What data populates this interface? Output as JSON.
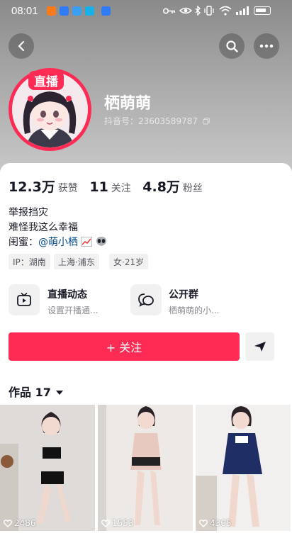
{
  "status_bar": {
    "time": "08:01"
  },
  "profile": {
    "live_badge": "直播",
    "username": "栖萌萌",
    "douyin_id": "抖音号：23603589787"
  },
  "stats": [
    {
      "value": "12.3万",
      "label": "获赞"
    },
    {
      "value": "11",
      "label": "关注"
    },
    {
      "value": "4.8万",
      "label": "粉丝"
    }
  ],
  "bio": {
    "line1": "举报挡灾",
    "line2": "难怪我这么幸福",
    "line3_prefix": "闺蜜：",
    "line3_mention": "@萌小栖"
  },
  "tags": [
    "IP：湖南",
    "上海·浦东",
    "女·21岁"
  ],
  "features": {
    "live": {
      "title": "直播动态",
      "subtitle": "设置开播通..."
    },
    "group": {
      "title": "公开群",
      "subtitle": "栖萌萌的小..."
    }
  },
  "follow_button": "+ 关注",
  "works": {
    "label": "作品 17"
  },
  "videos": [
    {
      "likes": "2486"
    },
    {
      "likes": "1553"
    },
    {
      "likes": "4365"
    }
  ],
  "colors": {
    "brand": "#fe2c55",
    "mention": "#04498d"
  },
  "icons": [
    "back-icon",
    "search-icon",
    "more-icon",
    "key-icon",
    "eye-icon",
    "bluetooth-icon",
    "wifi-icon",
    "signal-icon",
    "battery-icon",
    "tv-icon",
    "chat-group-icon",
    "share-arrow-icon",
    "caret-down-icon",
    "heart-icon"
  ]
}
